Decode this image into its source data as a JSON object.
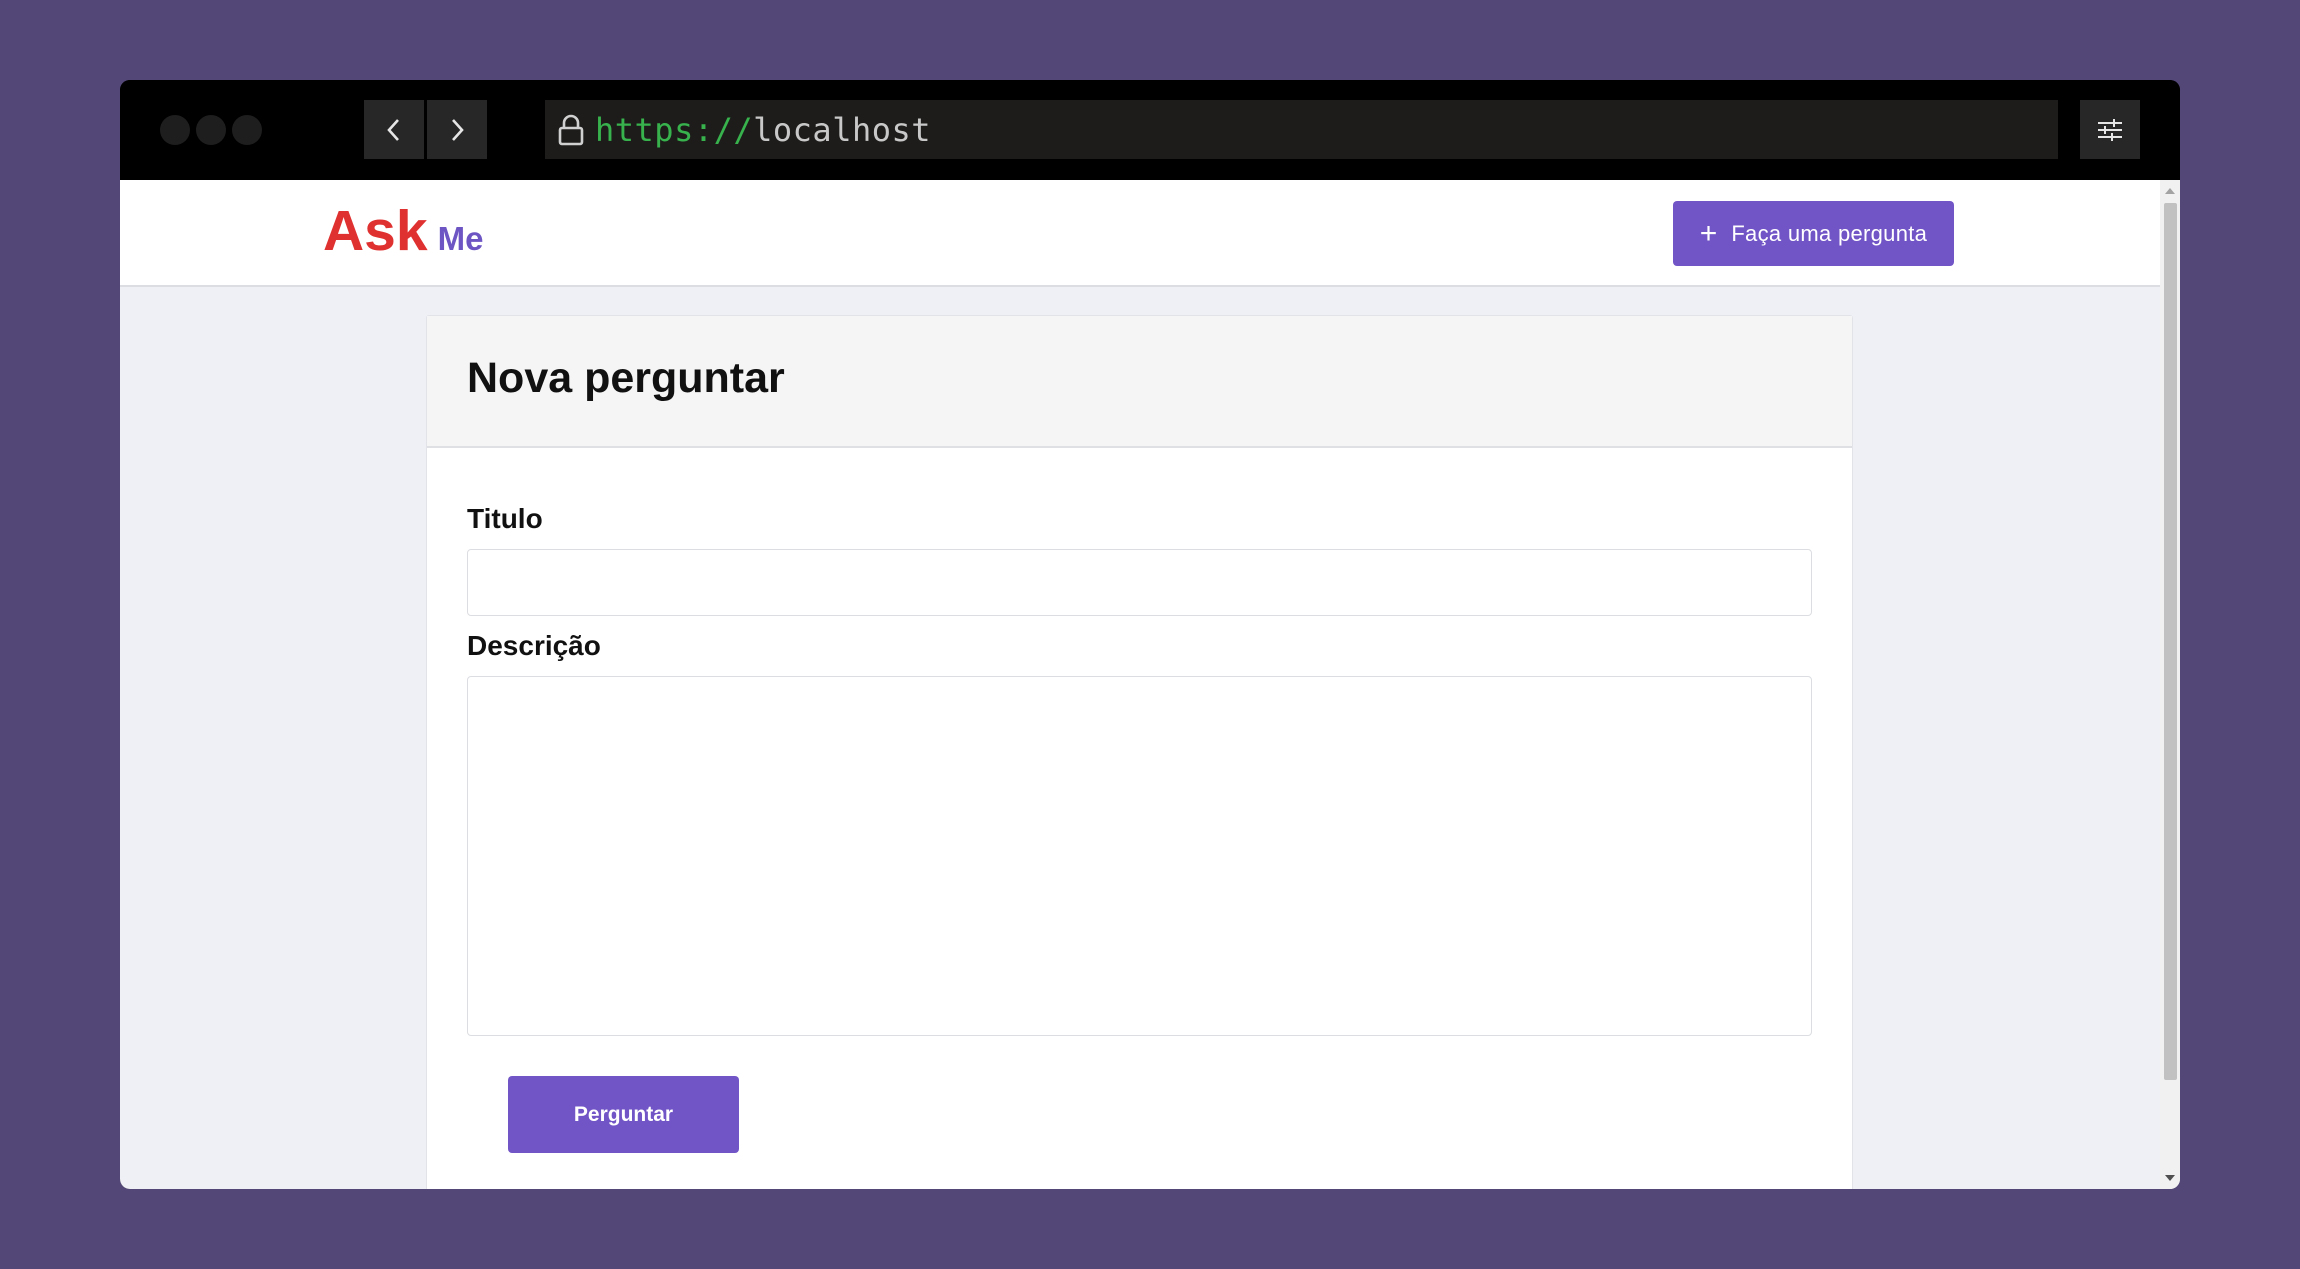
{
  "browser": {
    "url_scheme": "https://",
    "url_host": "localhost",
    "icons": [
      "window-dot-icon",
      "back-icon",
      "forward-icon",
      "lock-icon",
      "settings-sliders-icon"
    ]
  },
  "header": {
    "logo_part1": "Ask",
    "logo_part2": "Me",
    "ask_button": {
      "icon": "+",
      "label": "Faça uma pergunta"
    }
  },
  "form": {
    "title": "Nova perguntar",
    "fields": {
      "titulo": {
        "label": "Titulo",
        "value": "",
        "placeholder": ""
      },
      "descricao": {
        "label": "Descrição",
        "value": "",
        "placeholder": ""
      }
    },
    "submit_label": "Perguntar"
  },
  "colors": {
    "accent": "#7155c7",
    "logo_red": "#e03131",
    "logo_purple": "#6d55c4",
    "backdrop": "#534777"
  }
}
